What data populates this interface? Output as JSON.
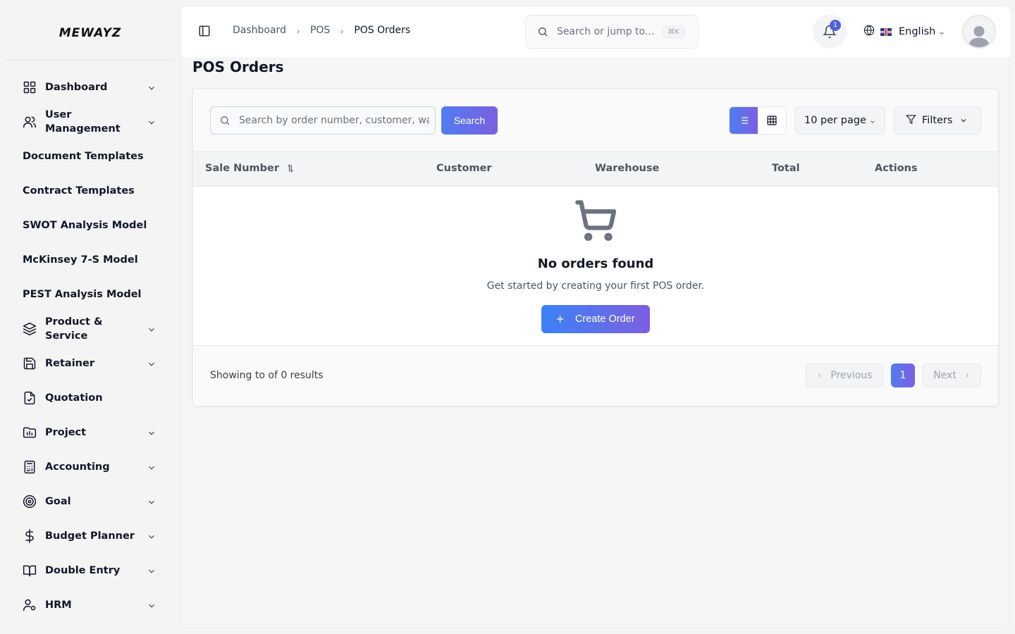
{
  "brand": {
    "logo_text": "MEWAYZ"
  },
  "sidebar": {
    "items": [
      {
        "label": "Dashboard",
        "icon": "grid-icon",
        "has_chevron": true
      },
      {
        "label": "User Management",
        "icon": "users-icon",
        "has_chevron": true
      },
      {
        "label": "Document Templates",
        "icon": null,
        "has_chevron": false
      },
      {
        "label": "Contract Templates",
        "icon": null,
        "has_chevron": false
      },
      {
        "label": "SWOT Analysis Model",
        "icon": null,
        "has_chevron": false
      },
      {
        "label": "McKinsey 7-S Model",
        "icon": null,
        "has_chevron": false
      },
      {
        "label": "PEST Analysis Model",
        "icon": null,
        "has_chevron": false
      },
      {
        "label": "Product & Service",
        "icon": "layers-icon",
        "has_chevron": true
      },
      {
        "label": "Retainer",
        "icon": "save-icon",
        "has_chevron": true
      },
      {
        "label": "Quotation",
        "icon": "file-check-icon",
        "has_chevron": false
      },
      {
        "label": "Project",
        "icon": "folder-chart-icon",
        "has_chevron": true
      },
      {
        "label": "Accounting",
        "icon": "calculator-icon",
        "has_chevron": true
      },
      {
        "label": "Goal",
        "icon": "target-icon",
        "has_chevron": true
      },
      {
        "label": "Budget Planner",
        "icon": "dollar-icon",
        "has_chevron": true
      },
      {
        "label": "Double Entry",
        "icon": "book-icon",
        "has_chevron": true
      },
      {
        "label": "HRM",
        "icon": "user-cog-icon",
        "has_chevron": true
      }
    ]
  },
  "header": {
    "breadcrumb": [
      "Dashboard",
      "POS",
      "POS Orders"
    ],
    "search_placeholder": "Search or jump to...",
    "search_shortcut": "⌘K",
    "notification_count": "1",
    "language": "English"
  },
  "page": {
    "title": "POS Orders",
    "search_placeholder": "Search by order number, customer, warehouse...",
    "search_button": "Search",
    "per_page": "10 per page",
    "filters_label": "Filters",
    "view_mode": "list"
  },
  "table": {
    "columns": [
      "Sale Number",
      "Customer",
      "Warehouse",
      "Total",
      "Actions"
    ],
    "rows": []
  },
  "empty_state": {
    "title": "No orders found",
    "description": "Get started by creating your first POS order.",
    "button": "Create Order"
  },
  "pagination": {
    "summary": "Showing to of 0 results",
    "previous": "Previous",
    "current_page": "1",
    "next": "Next"
  },
  "colors": {
    "accent_start": "#4f7df0",
    "accent_end": "#7c5fe0"
  }
}
